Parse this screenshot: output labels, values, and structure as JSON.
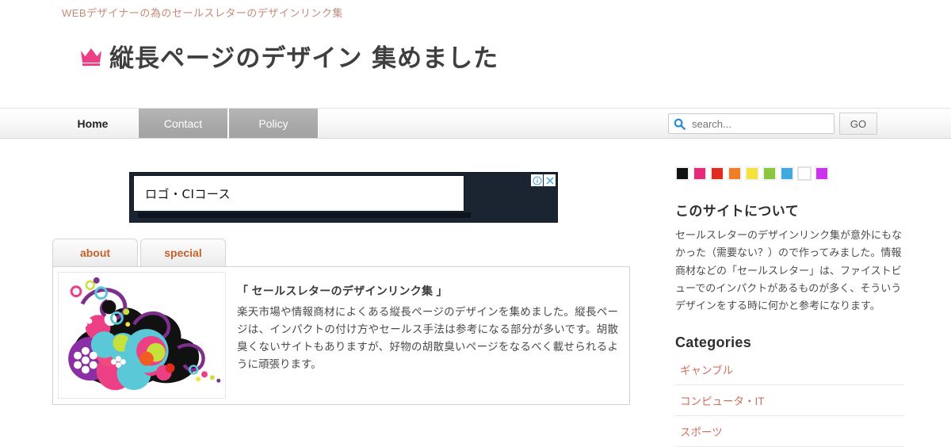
{
  "header": {
    "tagline": "WEBデザイナーの為のセールスレターのデザインリンク集",
    "logo_text": "縦長ページのデザイン 集めました",
    "crown_icon": "crown-icon",
    "crown_color": "#ec3f86",
    "tagline_color": "#c4897a"
  },
  "nav": {
    "items": [
      {
        "label": "Home",
        "active": true
      },
      {
        "label": "Contact",
        "active": false
      },
      {
        "label": "Policy",
        "active": false
      }
    ]
  },
  "search": {
    "icon": "search-icon",
    "placeholder": "search...",
    "value": "",
    "button_label": "GO"
  },
  "ad": {
    "text": "ロゴ・CIコース",
    "info_icon": "info-icon",
    "close_icon": "close-icon",
    "background_color": "#1b2531",
    "icon_color": "#4aa3df"
  },
  "tabs": [
    {
      "label": "about"
    },
    {
      "label": "special"
    }
  ],
  "content": {
    "art_name": "decorative-floral-circles-graphic",
    "title": "「 セールスレターのデザインリンク集 」",
    "body": "楽天市場や情報商材によくある縦長ページのデザインを集めました。縦長ページは、インパクトの付け方やセールス手法は参考になる部分が多いです。胡散臭くないサイトもありますが、好物の胡散臭いページをなるべく載せられるように頑張ります。"
  },
  "sidebar": {
    "swatches": [
      {
        "name": "black",
        "color": "#111111"
      },
      {
        "name": "pink",
        "color": "#e62a7b"
      },
      {
        "name": "red",
        "color": "#e02b20"
      },
      {
        "name": "orange",
        "color": "#f07e27"
      },
      {
        "name": "yellow",
        "color": "#f5e councils"
      },
      {
        "name": "green",
        "color": "#8cc63e"
      },
      {
        "name": "blue",
        "color": "#3fa9e0"
      },
      {
        "name": "white",
        "color": "#ffffff"
      },
      {
        "name": "magenta",
        "color": "#cc33ee"
      }
    ],
    "about_heading": "このサイトについて",
    "about_text": "セールスレターのデザインリンク集が意外にもなかった（需要ない？）ので作ってみました。情報商材などの「セールスレター」は、ファイストビューでのインパクトがあるものが多く、そういうデザインをする時に何かと参考になります。",
    "categories_heading": "Categories",
    "categories": [
      "ギャンブル",
      "コンピュータ・IT",
      "スポーツ"
    ],
    "link_color": "#d0705c"
  }
}
